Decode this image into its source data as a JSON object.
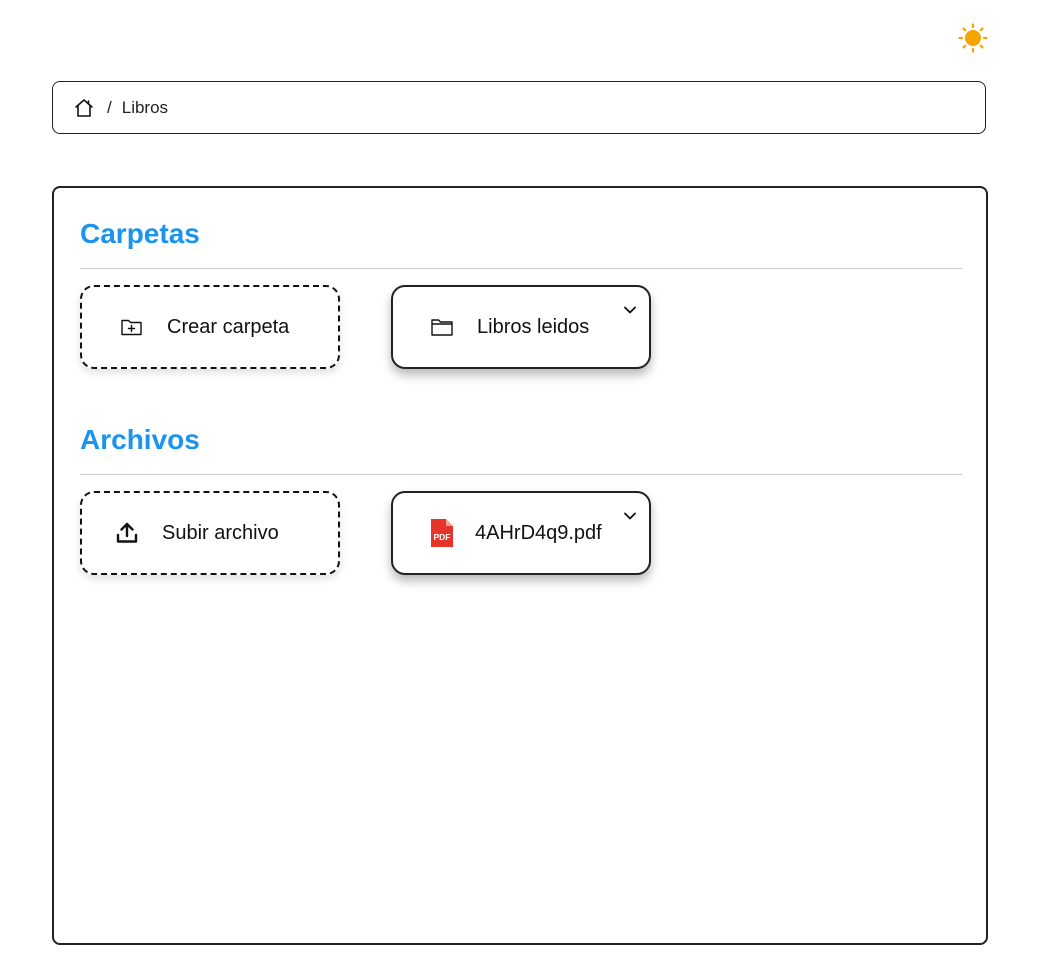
{
  "header": {
    "theme_icon": "sun-icon",
    "theme_color": "#f5a500"
  },
  "breadcrumb": {
    "home_icon": "home-icon",
    "separator": "/",
    "current": "Libros"
  },
  "sections": {
    "folders": {
      "title": "Carpetas",
      "create_label": "Crear carpeta",
      "create_icon": "folder-plus-icon",
      "items": [
        {
          "name": "Libros leidos",
          "icon": "folder-icon"
        }
      ]
    },
    "files": {
      "title": "Archivos",
      "upload_label": "Subir archivo",
      "upload_icon": "upload-icon",
      "items": [
        {
          "name": "4AHrD4q9.pdf",
          "icon": "pdf-file-icon",
          "badge": "PDF"
        }
      ]
    }
  },
  "colors": {
    "accent": "#1a94ee",
    "pdf_red": "#e5352b"
  }
}
